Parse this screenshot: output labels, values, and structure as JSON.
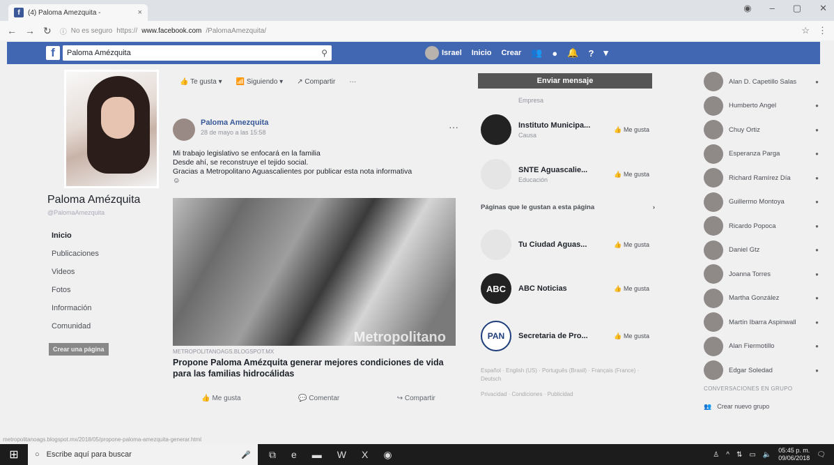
{
  "browser": {
    "tab_title": "(4) Paloma Amezquita -",
    "tab_close": "×",
    "url_secure": "No es seguro",
    "url_scheme": "https://",
    "url_host": "www.facebook.com",
    "url_path": "/PalomaAmezquita/"
  },
  "fb_header": {
    "logo": "f",
    "search_value": "Paloma Amézquita",
    "user": "Israel",
    "home": "Inicio",
    "create": "Crear"
  },
  "profile": {
    "name": "Paloma Amézquita",
    "handle": "@PalomaAmezquita",
    "menu": [
      "Inicio",
      "Publicaciones",
      "Videos",
      "Fotos",
      "Información",
      "Comunidad"
    ],
    "create_page": "Crear una página"
  },
  "page_actions": {
    "like": "Te gusta",
    "follow": "Siguiendo",
    "share": "Compartir",
    "more": "···"
  },
  "post": {
    "author": "Paloma Amezquita",
    "time": "28 de mayo a las 15:58",
    "more": "···",
    "line1": "Mi trabajo legislativo se enfocará en la familia",
    "line2": "Desde ahí, se reconstruye el tejido social.",
    "line3": "Gracias a Metropolitano Aguascalientes por publicar esta nota informativa",
    "emoji": "☺",
    "photo_watermark": "Metropolitano",
    "source": "METROPOLITANOAGS.BLOGSPOT.MX",
    "headline": "Propone Paloma Amézquita generar mejores condiciones de vida para las familias hidrocálidas",
    "like": "Me gusta",
    "comment": "Comentar",
    "share": "Compartir"
  },
  "right": {
    "send_message": "Enviar mensaje",
    "top_category": "Empresa",
    "pages": [
      {
        "name": "Instituto Municipa...",
        "category": "Causa",
        "like": "Me gusta"
      },
      {
        "name": "SNTE Aguascalie...",
        "category": "Educación",
        "like": "Me gusta"
      }
    ],
    "liked_title": "Páginas que le gustan a esta página",
    "liked_pages": [
      {
        "name": "Tu Ciudad Aguas...",
        "like": "Me gusta",
        "logo": ""
      },
      {
        "name": "ABC Noticias",
        "like": "Me gusta",
        "logo": "ABC"
      },
      {
        "name": "Secretaria de Pro...",
        "like": "Me gusta",
        "logo": "PAN"
      }
    ],
    "langs": "Español · English (US) · Português (Brasil) · Français (France) · Deutsch",
    "footer": "Privacidad · Condiciones · Publicidad"
  },
  "chat": {
    "contacts": [
      "Alan D. Capetillo Salas",
      "Humberto Angel",
      "Chuy Ortiz",
      "Esperanza Parga",
      "Richard Ramírez Día",
      "Guillermo Montoya",
      "Ricardo Popoca",
      "Daniel Gtz",
      "Joanna Torres",
      "Martha González",
      "Martín Ibarra Aspinwall",
      "Alan Fiermotillo",
      "Edgar Soledad"
    ],
    "group_title": "CONVERSACIONES EN GRUPO",
    "new_group": "Crear nuevo grupo"
  },
  "status_url": "metropolitanoags.blogspot.mx/2018/05/propone-paloma-amezquita-generar.html",
  "taskbar": {
    "search_placeholder": "Escribe aquí para buscar",
    "time": "05:45 p. m.",
    "date": "09/06/2018"
  }
}
